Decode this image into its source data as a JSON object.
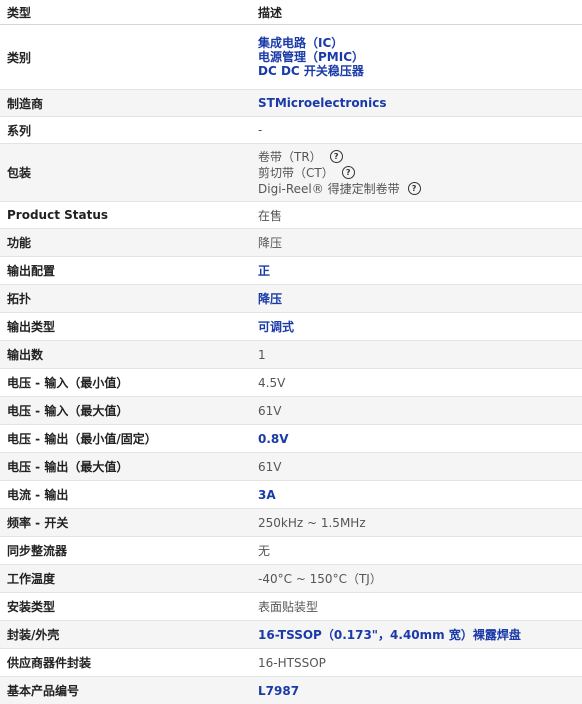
{
  "header": {
    "type_label": "类型",
    "desc_label": "描述"
  },
  "rows": {
    "category": {
      "label": "类别",
      "values": [
        "集成电路（IC）",
        "电源管理（PMIC）",
        "DC DC 开关稳压器"
      ]
    },
    "manufacturer": {
      "label": "制造商",
      "value": "STMicroelectronics"
    },
    "series": {
      "label": "系列",
      "value": "-"
    },
    "packaging": {
      "label": "包装",
      "values": [
        "卷带（TR）",
        "剪切带（CT）",
        "Digi-Reel® 得捷定制卷带"
      ],
      "help_icon": "help-circle-icon"
    },
    "product_status": {
      "label": "Product Status",
      "value": "在售"
    },
    "function": {
      "label": "功能",
      "value": "降压"
    },
    "output_config": {
      "label": "输出配置",
      "value": "正"
    },
    "topology": {
      "label": "拓扑",
      "value": "降压"
    },
    "output_type": {
      "label": "输出类型",
      "value": "可调式"
    },
    "num_outputs": {
      "label": "输出数",
      "value": "1"
    },
    "vin_min": {
      "label": "电压 - 输入（最小值）",
      "value": "4.5V"
    },
    "vin_max": {
      "label": "电压 - 输入（最大值）",
      "value": "61V"
    },
    "vout_min": {
      "label": "电压 - 输出（最小值/固定）",
      "value": "0.8V"
    },
    "vout_max": {
      "label": "电压 - 输出（最大值）",
      "value": "61V"
    },
    "iout": {
      "label": "电流 - 输出",
      "value": "3A"
    },
    "freq": {
      "label": "频率 - 开关",
      "value": "250kHz ~ 1.5MHz"
    },
    "sync_rect": {
      "label": "同步整流器",
      "value": "无"
    },
    "op_temp": {
      "label": "工作温度",
      "value": "-40°C ~ 150°C（TJ）"
    },
    "mount": {
      "label": "安装类型",
      "value": "表面贴装型"
    },
    "package_case": {
      "label": "封装/外壳",
      "value": "16-TSSOP（0.173\"，4.40mm 宽）裸露焊盘"
    },
    "supplier_pkg": {
      "label": "供应商器件封装",
      "value": "16-HTSSOP"
    },
    "base_part": {
      "label": "基本产品编号",
      "value": "L7987"
    }
  },
  "colors": {
    "link": "#1a3aa8",
    "alt_row": "#f5f5f5",
    "border": "#e3e3e3"
  }
}
